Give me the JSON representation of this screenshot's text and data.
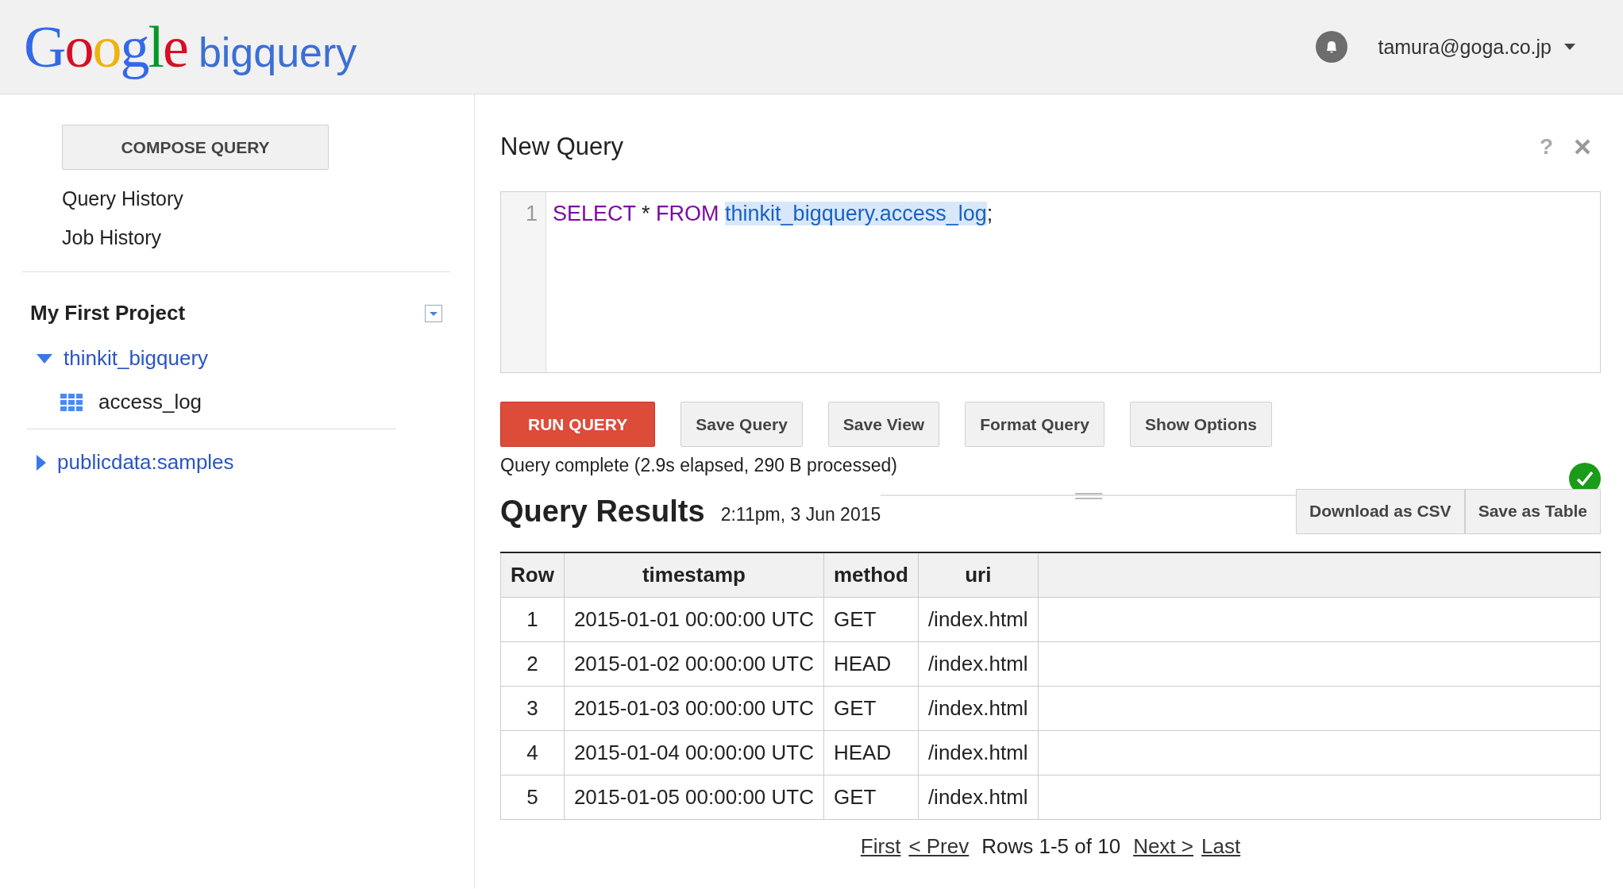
{
  "header": {
    "logo": {
      "brand": "Google",
      "product": "bigquery"
    },
    "account": "tamura@goga.co.jp"
  },
  "sidebar": {
    "compose_button": "COMPOSE QUERY",
    "links": [
      "Query History",
      "Job History"
    ],
    "project": {
      "name": "My First Project",
      "datasets": [
        {
          "name": "thinkit_bigquery",
          "expanded": true,
          "tables": [
            "access_log"
          ]
        },
        {
          "name": "publicdata:samples",
          "expanded": false
        }
      ]
    }
  },
  "editor": {
    "title": "New Query",
    "help": "?",
    "line_numbers": [
      "1"
    ],
    "tokens": [
      {
        "text": "SELECT",
        "kind": "keyword"
      },
      {
        "text": " * ",
        "kind": "plain"
      },
      {
        "text": "FROM ",
        "kind": "keyword"
      },
      {
        "text": "thinkit_bigquery.access_log",
        "kind": "table"
      },
      {
        "text": ";",
        "kind": "plain"
      }
    ]
  },
  "buttons": [
    {
      "label": "RUN QUERY",
      "kind": "primary"
    },
    {
      "label": "Save Query",
      "kind": "secondary"
    },
    {
      "label": "Save View",
      "kind": "secondary"
    },
    {
      "label": "Format Query",
      "kind": "secondary"
    },
    {
      "label": "Show Options",
      "kind": "secondary"
    }
  ],
  "status": {
    "text": "Query complete (2.9s elapsed, 290 B processed)",
    "success": true
  },
  "results": {
    "title": "Query Results",
    "time": "2:11pm, 3 Jun 2015",
    "actions": [
      "Download as CSV",
      "Save as Table"
    ],
    "table": {
      "columns": [
        "Row",
        "timestamp",
        "method",
        "uri"
      ],
      "rows": [
        [
          "1",
          "2015-01-01 00:00:00 UTC",
          "GET",
          "/index.html"
        ],
        [
          "2",
          "2015-01-02 00:00:00 UTC",
          "HEAD",
          "/index.html"
        ],
        [
          "3",
          "2015-01-03 00:00:00 UTC",
          "GET",
          "/index.html"
        ],
        [
          "4",
          "2015-01-04 00:00:00 UTC",
          "HEAD",
          "/index.html"
        ],
        [
          "5",
          "2015-01-05 00:00:00 UTC",
          "GET",
          "/index.html"
        ]
      ]
    },
    "pagination": {
      "first": "First",
      "prev": "< Prev",
      "summary": "Rows 1-5 of 10",
      "next": "Next >",
      "last": "Last"
    }
  }
}
